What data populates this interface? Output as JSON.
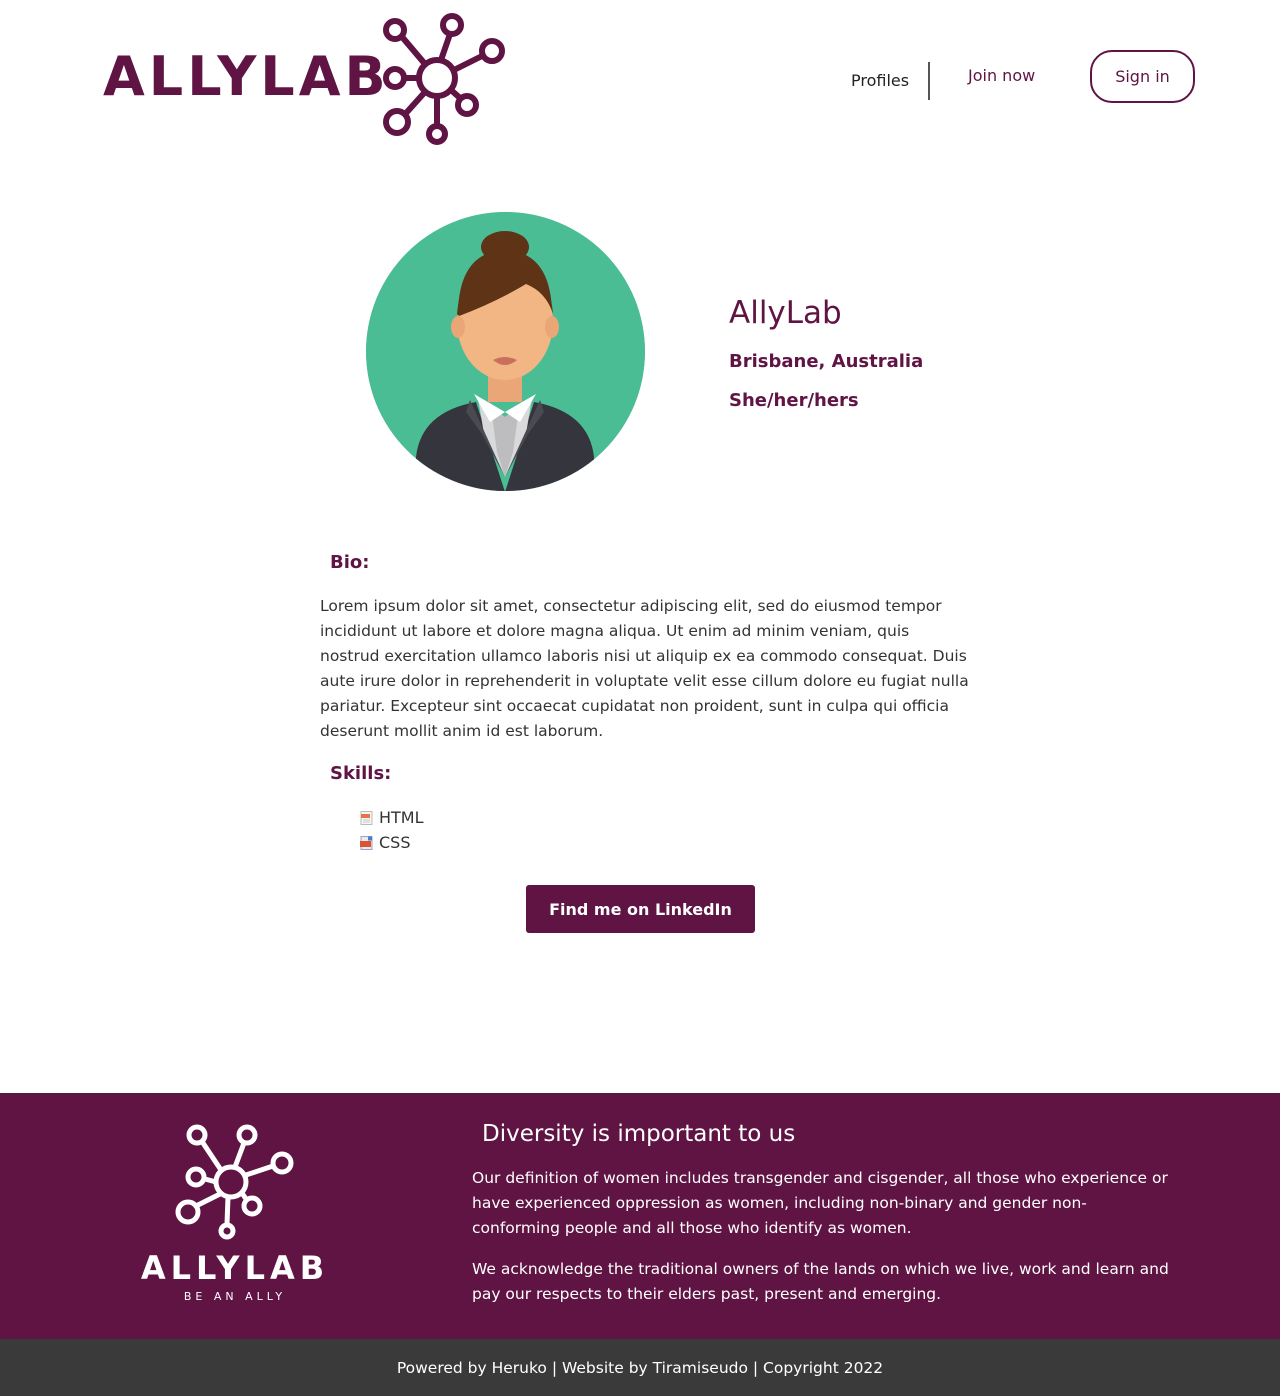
{
  "header": {
    "logo_text": "ALLYLAB",
    "nav": {
      "profiles": "Profiles",
      "join_now": "Join now",
      "sign_in": "Sign in"
    }
  },
  "profile": {
    "name": "AllyLab",
    "location": "Brisbane, Australia",
    "pronouns": "She/her/hers",
    "avatar_icon": "woman-avatar-icon"
  },
  "bio": {
    "heading": "Bio:",
    "text": "Lorem ipsum dolor sit amet, consectetur adipiscing elit, sed do eiusmod tempor incididunt ut labore et dolore magna aliqua. Ut enim ad minim veniam, quis nostrud exercitation ullamco laboris nisi ut aliquip ex ea commodo consequat. Duis aute irure dolor in reprehenderit in voluptate velit esse cillum dolore eu fugiat nulla pariatur. Excepteur sint occaecat cupidatat non proident, sunt in culpa qui officia deserunt mollit anim id est laborum."
  },
  "skills": {
    "heading": "Skills:",
    "items": [
      {
        "label": "HTML",
        "icon": "html-file-icon"
      },
      {
        "label": "CSS",
        "icon": "css-file-icon"
      }
    ]
  },
  "linkedin_button": "Find me on LinkedIn",
  "footer": {
    "logo_text": "ALLYLAB",
    "tagline": "BE AN ALLY",
    "heading": "Diversity is important to us",
    "paragraph1": "Our definition of women includes transgender and cisgender, all those who experience or have experienced oppression as women, including non-binary and gender non-conforming people and all those who identify as women.",
    "paragraph2": "We acknowledge the traditional owners of the lands on which we live, work and learn and pay our respects to their elders past, present and emerging.",
    "copyright": "Powered by Heruko | Website by Tiramiseudo | Copyright 2022"
  },
  "colors": {
    "brand": "#5f1443",
    "avatar_bg": "#4bbd95",
    "copyright_bg": "#3a3a3a"
  }
}
